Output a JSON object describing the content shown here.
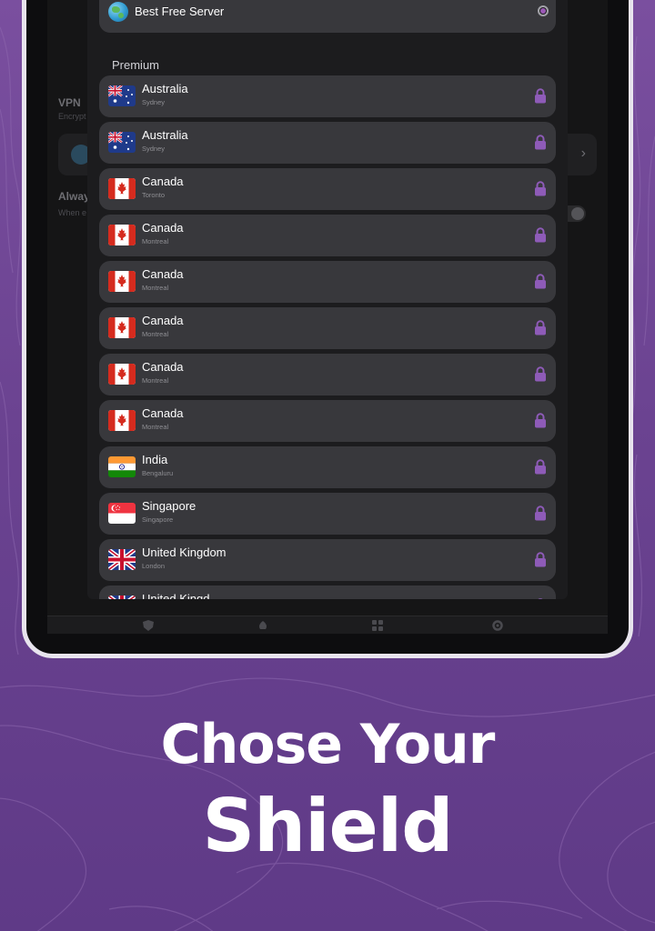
{
  "free_server": {
    "label": "Best Free Server",
    "icon": "globe-icon",
    "selected": true
  },
  "premium": {
    "section_label": "Premium",
    "servers": [
      {
        "country": "Australia",
        "city": "Sydney",
        "flag": "au",
        "locked": true
      },
      {
        "country": "Australia",
        "city": "Sydney",
        "flag": "au",
        "locked": true
      },
      {
        "country": "Canada",
        "city": "Toronto",
        "flag": "ca",
        "locked": true
      },
      {
        "country": "Canada",
        "city": "Montreal",
        "flag": "ca",
        "locked": true
      },
      {
        "country": "Canada",
        "city": "Montreal",
        "flag": "ca",
        "locked": true
      },
      {
        "country": "Canada",
        "city": "Montreal",
        "flag": "ca",
        "locked": true
      },
      {
        "country": "Canada",
        "city": "Montreal",
        "flag": "ca",
        "locked": true
      },
      {
        "country": "Canada",
        "city": "Montreal",
        "flag": "ca",
        "locked": true
      },
      {
        "country": "India",
        "city": "Bengaluru",
        "flag": "in",
        "locked": true
      },
      {
        "country": "Singapore",
        "city": "Singapore",
        "flag": "sg",
        "locked": true
      },
      {
        "country": "United Kingdom",
        "city": "London",
        "flag": "gb",
        "locked": true
      },
      {
        "country": "United Kingd",
        "city": "",
        "flag": "gb",
        "locked": true
      }
    ]
  },
  "background_app": {
    "vpn_title": "VPN",
    "vpn_subtitle": "Encrypt",
    "always_title": "Alway",
    "always_subtitle": "When e"
  },
  "tabbar": {
    "tabs": [
      "shield-icon",
      "onion-icon",
      "apps-icon",
      "gear-icon"
    ]
  },
  "headline": {
    "line1": "Chose Your",
    "line2": "Shield"
  },
  "colors": {
    "background": "#6b4391",
    "accent": "#9b59b6",
    "row_background": "#38383c",
    "sheet_background": "#1c1c1e",
    "text_primary": "#ffffff",
    "text_secondary": "#8e8e93"
  }
}
